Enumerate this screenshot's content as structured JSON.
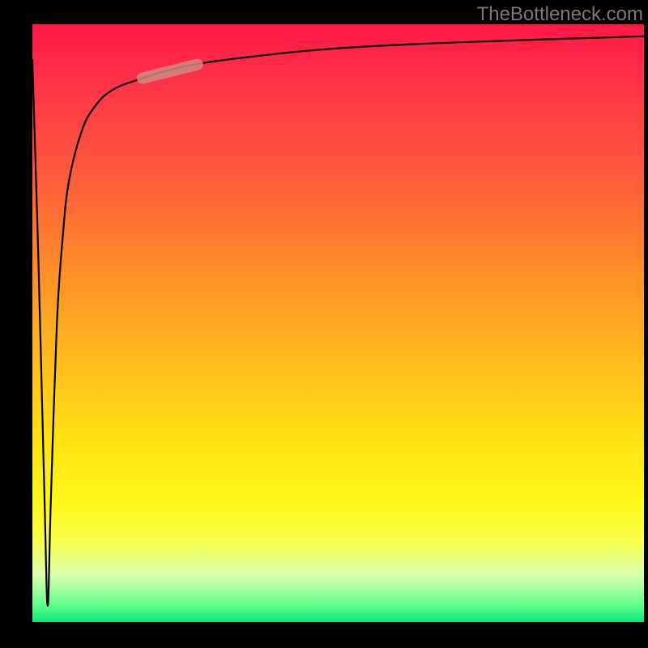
{
  "attribution": "TheBottleneck.com",
  "colors": {
    "frame": "#000000",
    "attribution_text": "#7a7a7a",
    "curve": "#000000",
    "marker": "#d08a80",
    "gradient_top": "#ff1744",
    "gradient_mid": "#ffe313",
    "gradient_bottom": "#00e676"
  },
  "chart_data": {
    "type": "line",
    "title": "",
    "xlabel": "",
    "ylabel": "",
    "xlim": [
      0,
      100
    ],
    "ylim": [
      0,
      100
    ],
    "grid": false,
    "series": [
      {
        "name": "bottleneck-curve",
        "x": [
          0,
          1,
          2,
          2.5,
          3,
          4,
          5,
          6,
          8,
          10,
          13,
          18,
          25,
          35,
          50,
          70,
          100
        ],
        "y": [
          94,
          60,
          20,
          3,
          20,
          50,
          65,
          74,
          82,
          86,
          89,
          91,
          93,
          94.5,
          96,
          97,
          98
        ],
        "note": "y is percent height from bottom (0) to top (100); sharp spike down near x≈2.5 then asymptotic rise toward top"
      }
    ],
    "annotations": [
      {
        "name": "highlight-segment",
        "x_range": [
          18,
          27
        ],
        "description": "short rounded pale-pink segment overlaid on curve"
      }
    ]
  }
}
